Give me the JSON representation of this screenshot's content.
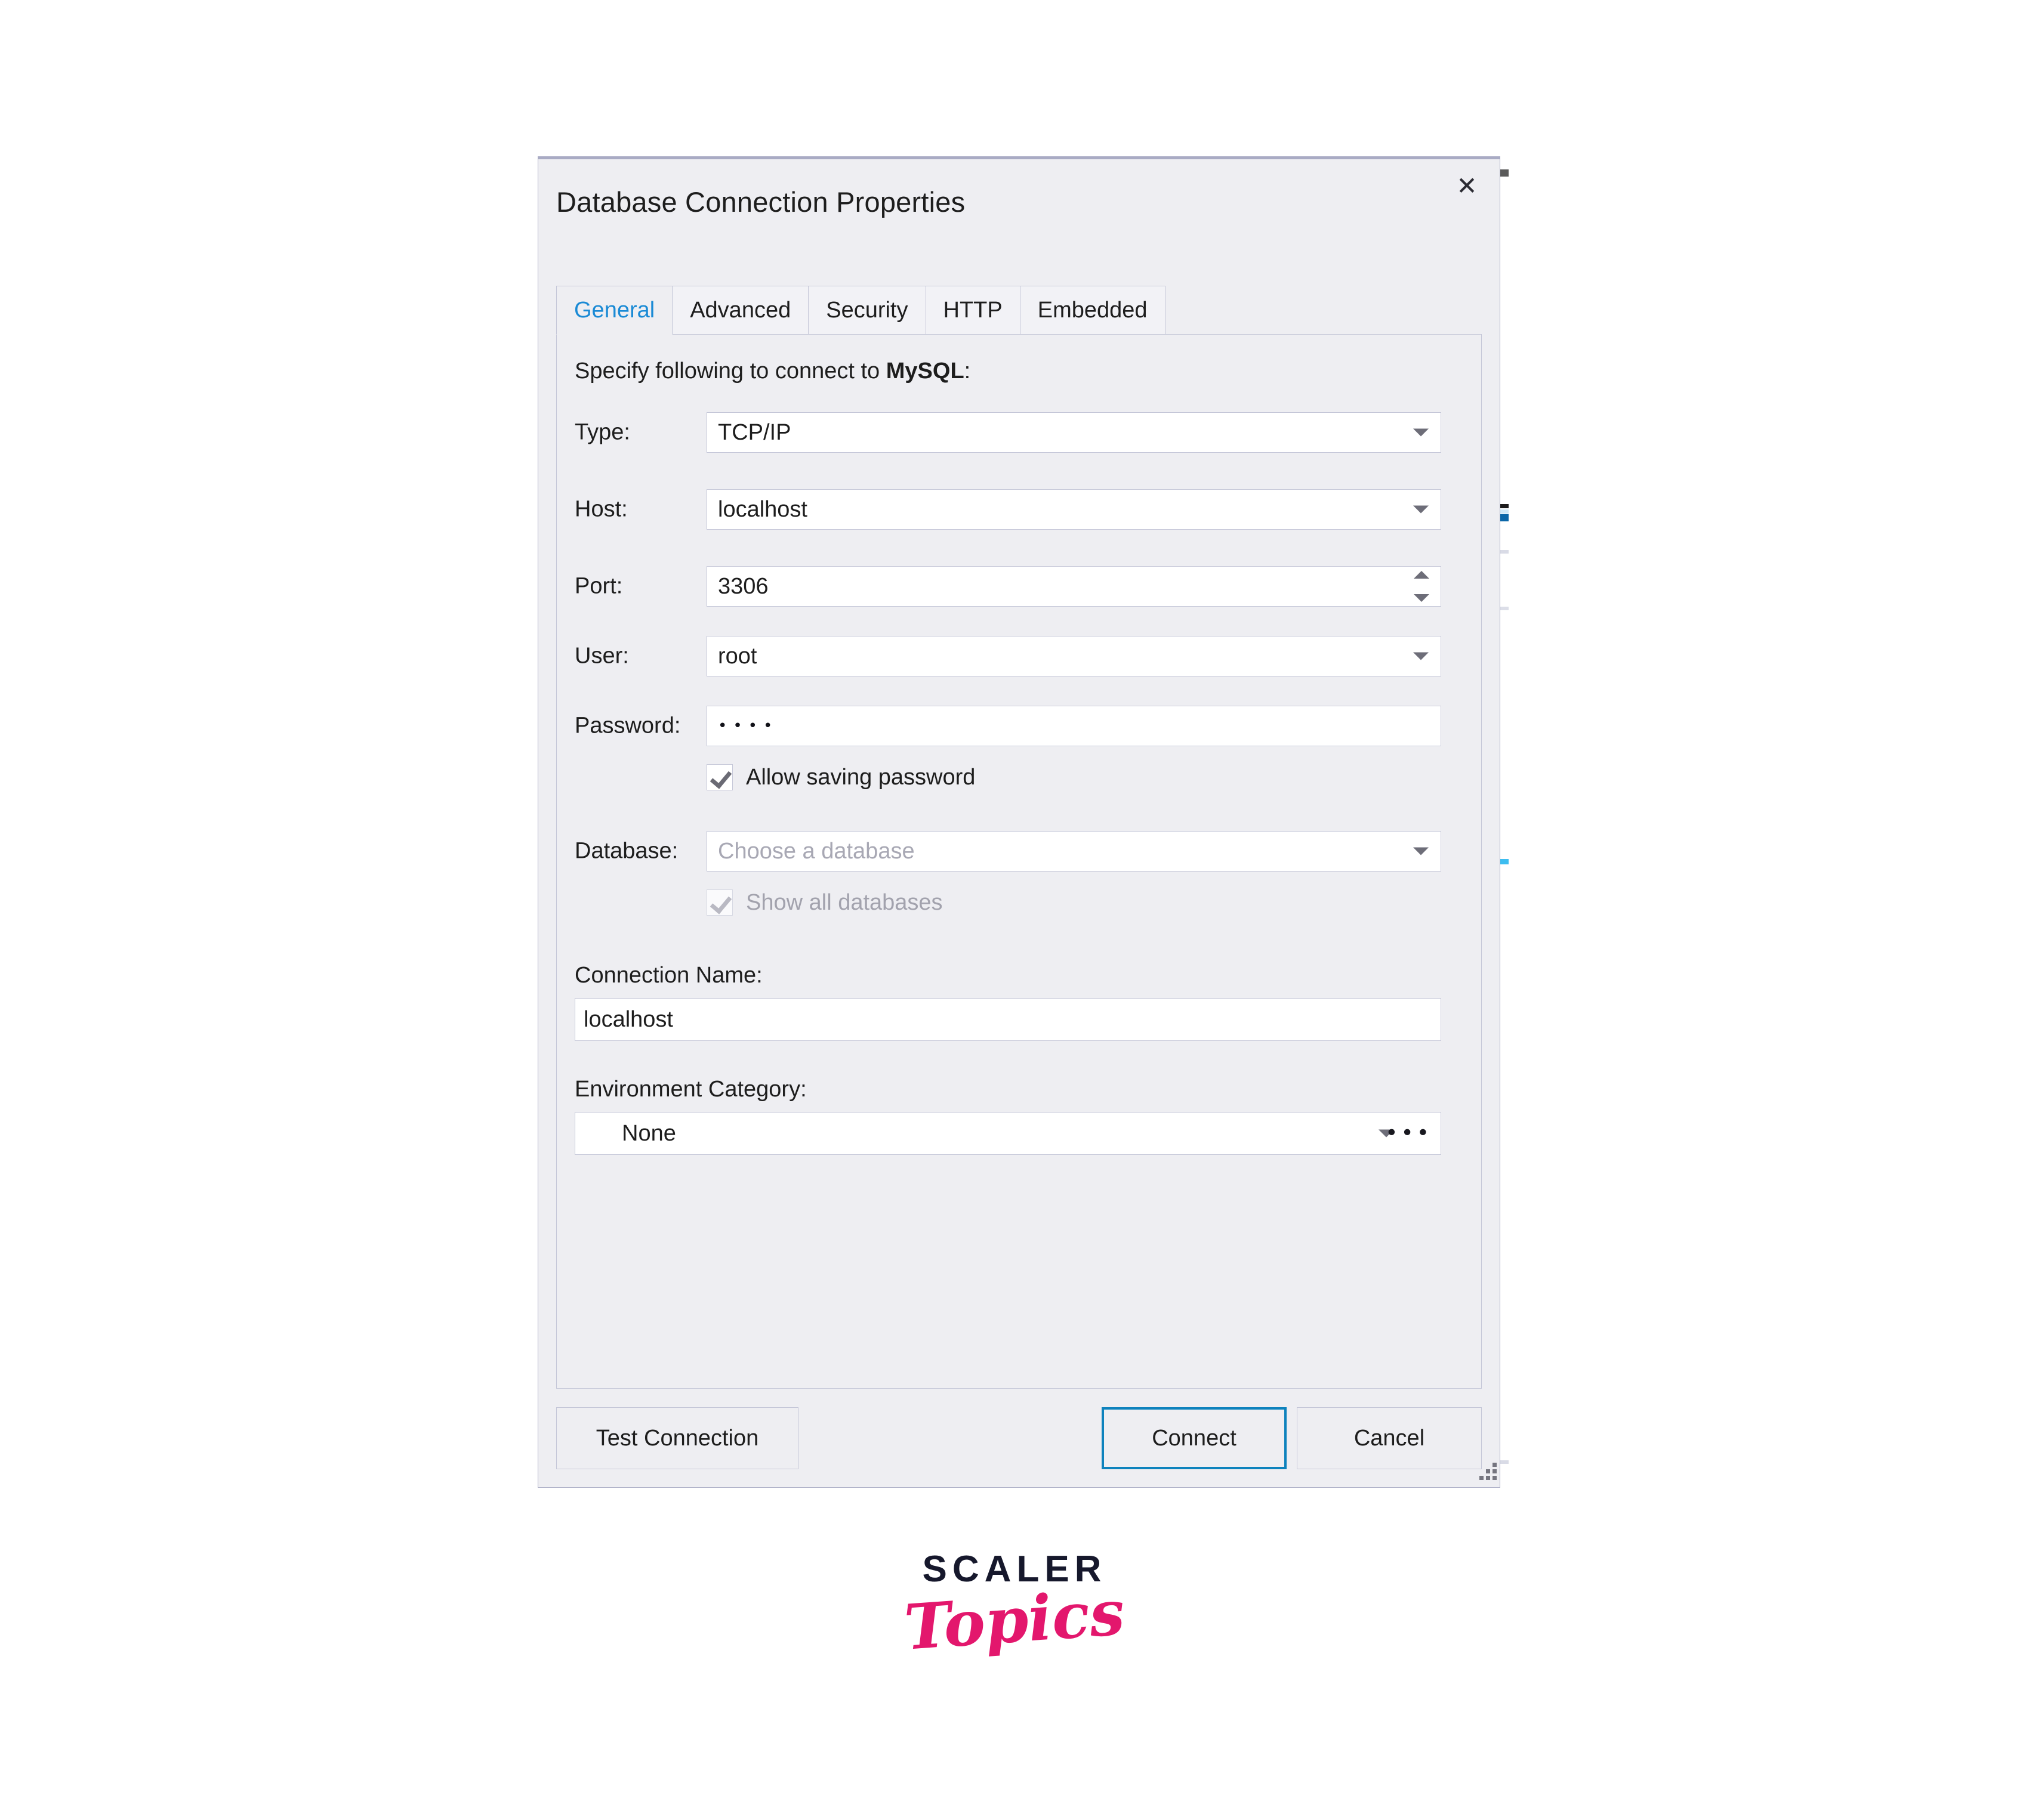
{
  "dialog": {
    "title": "Database Connection Properties",
    "close_icon": "close-icon"
  },
  "tabs": [
    {
      "label": "General",
      "active": true
    },
    {
      "label": "Advanced",
      "active": false
    },
    {
      "label": "Security",
      "active": false
    },
    {
      "label": "HTTP",
      "active": false
    },
    {
      "label": "Embedded",
      "active": false
    }
  ],
  "general": {
    "intro_prefix": "Specify following to connect to ",
    "intro_strong": "MySQL",
    "intro_suffix": ":",
    "fields": {
      "type": {
        "label": "Type:",
        "value": "TCP/IP"
      },
      "host": {
        "label": "Host:",
        "value": "localhost"
      },
      "port": {
        "label": "Port:",
        "value": "3306"
      },
      "user": {
        "label": "User:",
        "value": "root"
      },
      "password": {
        "label": "Password:",
        "value": "••••"
      },
      "database": {
        "label": "Database:",
        "value": "",
        "placeholder": "Choose a database"
      }
    },
    "allow_saving_password": {
      "label": "Allow saving password",
      "checked": true,
      "enabled": true
    },
    "show_all_databases": {
      "label": "Show all databases",
      "checked": true,
      "enabled": false
    },
    "connection_name": {
      "label": "Connection Name:",
      "value": "localhost"
    },
    "environment_category": {
      "label": "Environment Category:",
      "value": "None",
      "more_label": "•••"
    }
  },
  "footer": {
    "test_connection": "Test Connection",
    "connect": "Connect",
    "cancel": "Cancel"
  },
  "watermark": {
    "brand": "SCALER",
    "sub": "Topics"
  },
  "colors": {
    "accent_blue": "#1a8ad5",
    "primary_border": "#0d82bd",
    "dialog_bg": "#eeeef2",
    "brand_pink": "#e3176d",
    "brand_dark": "#16182c"
  }
}
